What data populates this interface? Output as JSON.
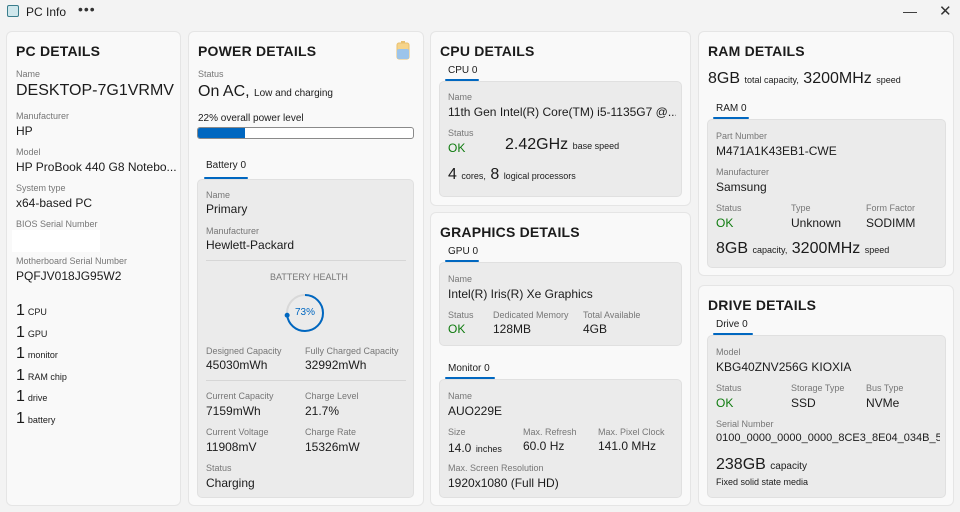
{
  "window": {
    "title": "PC Info",
    "more_glyph": "•••",
    "minimize_glyph": "—",
    "close_glyph": "✕"
  },
  "pc": {
    "title": "PC DETAILS",
    "name_label": "Name",
    "name": "DESKTOP-7G1VRMV",
    "manufacturer_label": "Manufacturer",
    "manufacturer": "HP",
    "model_label": "Model",
    "model": "HP ProBook 440 G8 Notebo...",
    "system_type_label": "System type",
    "system_type": "x64-based PC",
    "bios_serial_label": "BIOS Serial Number",
    "mb_serial_label": "Motherboard Serial Number",
    "mb_serial": "PQFJV018JG95W2",
    "counts": [
      {
        "n": "1",
        "unit": "CPU"
      },
      {
        "n": "1",
        "unit": "GPU"
      },
      {
        "n": "1",
        "unit": "monitor"
      },
      {
        "n": "1",
        "unit": "RAM chip"
      },
      {
        "n": "1",
        "unit": "drive"
      },
      {
        "n": "1",
        "unit": "battery"
      }
    ]
  },
  "power": {
    "title": "POWER DETAILS",
    "status_label": "Status",
    "status_main": "On AC,",
    "status_sub": "Low and charging",
    "level_pct": "22%",
    "level_text": "overall power level",
    "level_fraction": 0.22,
    "battery_tab": "Battery 0",
    "name_label": "Name",
    "name": "Primary",
    "manufacturer_label": "Manufacturer",
    "manufacturer": "Hewlett-Packard",
    "health_label": "BATTERY HEALTH",
    "health_pct": "73%",
    "health_fraction": 0.73,
    "designed_label": "Designed Capacity",
    "designed": "45030mWh",
    "full_label": "Fully Charged Capacity",
    "full": "32992mWh",
    "current_cap_label": "Current Capacity",
    "current_cap": "7159mWh",
    "charge_level_label": "Charge Level",
    "charge_level": "21.7%",
    "voltage_label": "Current Voltage",
    "voltage": "11908mV",
    "rate_label": "Charge Rate",
    "rate": "15326mW",
    "bstatus_label": "Status",
    "bstatus": "Charging"
  },
  "cpu": {
    "title": "CPU DETAILS",
    "tab": "CPU 0",
    "name_label": "Name",
    "name": "11th Gen Intel(R) Core(TM) i5-1135G7 @...",
    "status_label": "Status",
    "status": "OK",
    "speed": "2.42GHz",
    "speed_unit": "base speed",
    "cores": "4",
    "cores_unit": "cores,",
    "logical": "8",
    "logical_unit": "logical processors"
  },
  "gpu": {
    "title": "GRAPHICS DETAILS",
    "tab": "GPU 0",
    "name_label": "Name",
    "name": "Intel(R) Iris(R) Xe Graphics",
    "status_label": "Status",
    "status": "OK",
    "dedicated_label": "Dedicated Memory",
    "dedicated": "128MB",
    "total_label": "Total Available",
    "total": "4GB",
    "monitor_tab": "Monitor 0",
    "m_name_label": "Name",
    "m_name": "AUO229E",
    "size_label": "Size",
    "size": "14.0",
    "size_unit": "inches",
    "refresh_label": "Max. Refresh",
    "refresh": "60.0 Hz",
    "clock_label": "Max. Pixel Clock",
    "clock": "141.0 MHz",
    "res_label": "Max. Screen Resolution",
    "res": "1920x1080 (Full HD)"
  },
  "ram": {
    "title": "RAM DETAILS",
    "total": "8GB",
    "total_unit": "total capacity,",
    "speed": "3200MHz",
    "speed_unit": "speed",
    "tab": "RAM 0",
    "part_label": "Part Number",
    "part": "M471A1K43EB1-CWE",
    "manufacturer_label": "Manufacturer",
    "manufacturer": "Samsung",
    "status_label": "Status",
    "status": "OK",
    "type_label": "Type",
    "type": "Unknown",
    "ff_label": "Form Factor",
    "ff": "SODIMM",
    "cap": "8GB",
    "cap_unit": "capacity,",
    "cap_speed": "3200MHz",
    "cap_speed_unit": "speed"
  },
  "drive": {
    "title": "DRIVE DETAILS",
    "tab": "Drive 0",
    "model_label": "Model",
    "model": "KBG40ZNV256G KIOXIA",
    "status_label": "Status",
    "status": "OK",
    "storage_label": "Storage Type",
    "storage": "SSD",
    "bus_label": "Bus Type",
    "bus": "NVMe",
    "serial_label": "Serial Number",
    "serial": "0100_0000_0000_0000_8CE3_8E04_034B_5...",
    "capacity": "238GB",
    "capacity_unit": "capacity",
    "media": "Fixed solid state media"
  },
  "colors": {
    "accent": "#0067c0",
    "ok": "#0f7b0f"
  }
}
